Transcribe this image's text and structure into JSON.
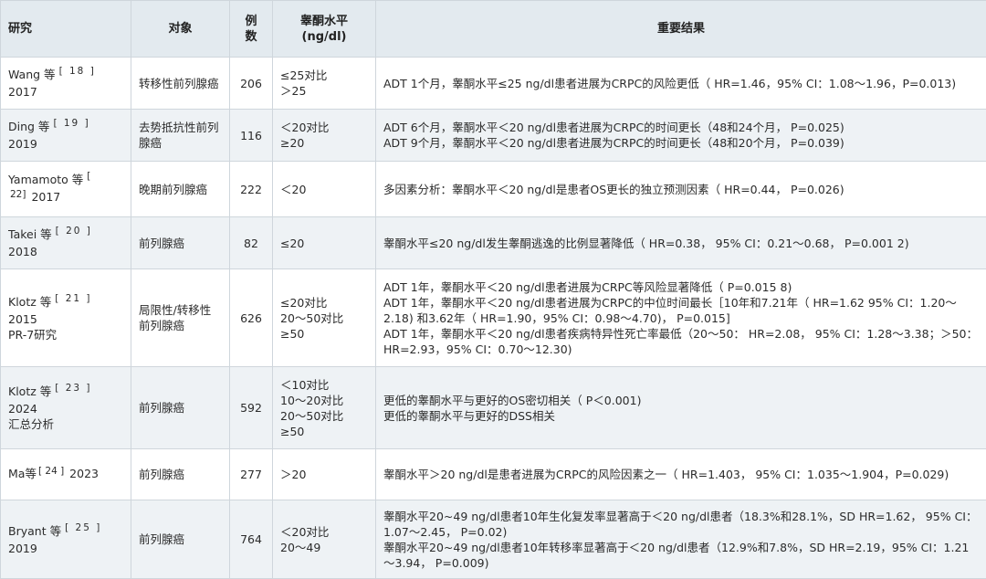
{
  "table": {
    "headers": {
      "study": "研究",
      "subject": "对象",
      "cases": [
        "例",
        "数"
      ],
      "testosterone": [
        "睾酮水平",
        "(ng/dl)"
      ],
      "results": "重要结果"
    },
    "rows": [
      {
        "author": "Wang 等",
        "ref": "[ 18 ]",
        "year": "2017",
        "subject": "转移性前列腺癌",
        "n": "206",
        "levels": [
          "≤25对比",
          "＞25"
        ],
        "results": [
          "ADT 1个月，睾酮水平≤25 ng/dl患者进展为CRPC的风险更低（ HR=1.46，95% CI：1.08～1.96，P=0.013)"
        ]
      },
      {
        "author": "Ding 等",
        "ref": "[ 19 ]",
        "year": "2019",
        "subject": "去势抵抗性前列腺癌",
        "n": "116",
        "levels": [
          "＜20对比",
          "≥20"
        ],
        "results": [
          "ADT 6个月，睾酮水平＜20 ng/dl患者进展为CRPC的时间更长（48和24个月， P=0.025)",
          "ADT 9个月，睾酮水平＜20 ng/dl患者进展为CRPC的时间更长（48和20个月， P=0.039)"
        ]
      },
      {
        "author": "Yamamoto 等",
        "ref": "[",
        "year": "2017",
        "ref_cont": "22]",
        "subject": "晚期前列腺癌",
        "n": "222",
        "levels": [
          "＜20"
        ],
        "results": [
          "多因素分析：睾酮水平＜20 ng/dl是患者OS更长的独立预测因素（ HR=0.44， P=0.026)"
        ]
      },
      {
        "author": "Takei 等",
        "ref": "[ 20 ]",
        "year": "2018",
        "subject": "前列腺癌",
        "n": "82",
        "levels": [
          "≤20"
        ],
        "results": [
          "睾酮水平≤20 ng/dl发生睾酮逃逸的比例显著降低（ HR=0.38， 95% CI：0.21～0.68， P=0.001 2)"
        ]
      },
      {
        "author": "Klotz 等",
        "ref": "[ 21 ]",
        "year": "2015",
        "extra": "PR-7研究",
        "subject": "局限性/转移性前列腺癌",
        "n": "626",
        "levels": [
          "≤20对比",
          "20～50对比",
          "≥50"
        ],
        "results": [
          "ADT 1年，睾酮水平＜20 ng/dl患者进展为CRPC等风险显著降低（ P=0.015 8)",
          "ADT 1年，睾酮水平＜20 ng/dl患者进展为CRPC的中位时间最长［10年和7.21年（ HR=1.62 95% CI：1.20～2.18) 和3.62年（ HR=1.90，95% CI：0.98～4.70)， P=0.015]",
          "ADT 1年，睾酮水平＜20 ng/dl患者疾病特异性死亡率最低（20～50： HR=2.08， 95% CI：1.28～3.38；＞50： HR=2.93，95% CI：0.70～12.30)"
        ]
      },
      {
        "author": "Klotz 等",
        "ref": "[ 23 ]",
        "year": "2024",
        "extra": "汇总分析",
        "subject": "前列腺癌",
        "n": "592",
        "levels": [
          "＜10对比",
          "10～20对比",
          "20～50对比",
          "≥50"
        ],
        "results": [
          "更低的睾酮水平与更好的OS密切相关（ P＜0.001)",
          "更低的睾酮水平与更好的DSS相关"
        ]
      },
      {
        "author": "Ma等",
        "ref": "[ 24 ]",
        "year": "2023",
        "subject": "前列腺癌",
        "n": "277",
        "levels": [
          "＞20"
        ],
        "results": [
          "睾酮水平＞20 ng/dl是患者进展为CRPC的风险因素之一（ HR=1.403， 95% CI：1.035～1.904，P=0.029)"
        ]
      },
      {
        "author": "Bryant 等",
        "ref": "[ 25 ]",
        "year": "2019",
        "subject": "前列腺癌",
        "n": "764",
        "levels": [
          "＜20对比",
          "20～49"
        ],
        "results": [
          "睾酮水平20~49 ng/dl患者10年生化复发率显著高于＜20 ng/dl患者（18.3%和28.1%，SD HR=1.62， 95% CI：1.07～2.45， P=0.02)",
          "睾酮水平20~49 ng/dl患者10年转移率显著高于＜20 ng/dl患者（12.9%和7.8%，SD HR=2.19，95% CI：1.21～3.94， P=0.009)"
        ]
      }
    ]
  }
}
